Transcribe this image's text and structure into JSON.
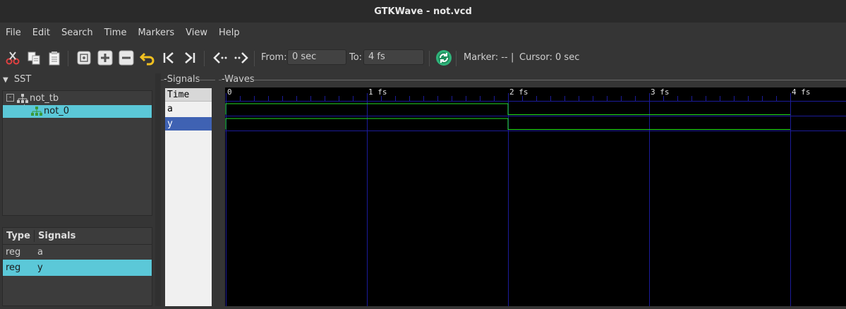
{
  "window": {
    "title": "GTKWave - not.vcd"
  },
  "menu": [
    "File",
    "Edit",
    "Search",
    "Time",
    "Markers",
    "View",
    "Help"
  ],
  "toolbar": {
    "icons": [
      "cut-icon",
      "copy-icon",
      "paste-icon",
      "zoom-fit-icon",
      "zoom-in-icon",
      "zoom-out-icon",
      "undo-zoom-icon",
      "zoom-to-start-icon",
      "zoom-to-end-icon",
      "find-previous-edge-icon",
      "find-next-edge-icon",
      "reload-icon"
    ],
    "from_label": "From:",
    "from_value": "0 sec",
    "to_label": "To:",
    "to_value": "4 fs",
    "marker_text": "Marker: --",
    "separator": "|",
    "cursor_text": "Cursor: 0 sec"
  },
  "sst": {
    "header": "SST",
    "tree": [
      {
        "label": "not_tb",
        "expanded": true
      },
      {
        "label": "not_0",
        "selected": true
      }
    ]
  },
  "signal_list": {
    "col_type": "Type",
    "col_signals": "Signals",
    "rows": [
      {
        "type": "reg",
        "name": "a",
        "selected": false
      },
      {
        "type": "reg",
        "name": "y",
        "selected": true
      }
    ]
  },
  "signals_pane": {
    "label": "Signals",
    "time_row": "Time",
    "rows": [
      {
        "name": "a",
        "selected": false
      },
      {
        "name": "y",
        "selected": true
      }
    ]
  },
  "waves_pane": {
    "label": "Waves",
    "ticks": [
      {
        "t": 0,
        "label": "0"
      },
      {
        "t": 1,
        "label": "1 fs"
      },
      {
        "t": 2,
        "label": "2 fs"
      },
      {
        "t": 3,
        "label": "3 fs"
      },
      {
        "t": 4,
        "label": "4 fs"
      }
    ],
    "t_max": 4,
    "signals": [
      {
        "name": "a",
        "transitions": [
          [
            0,
            1
          ],
          [
            2,
            0
          ]
        ]
      },
      {
        "name": "y",
        "transitions": [
          [
            0,
            1
          ],
          [
            2,
            0
          ]
        ]
      }
    ]
  },
  "colors": {
    "selection": "#5bc8d8",
    "signal_select": "#3f62b3",
    "wave": "#22dd22",
    "grid": "#1b1b9a"
  }
}
